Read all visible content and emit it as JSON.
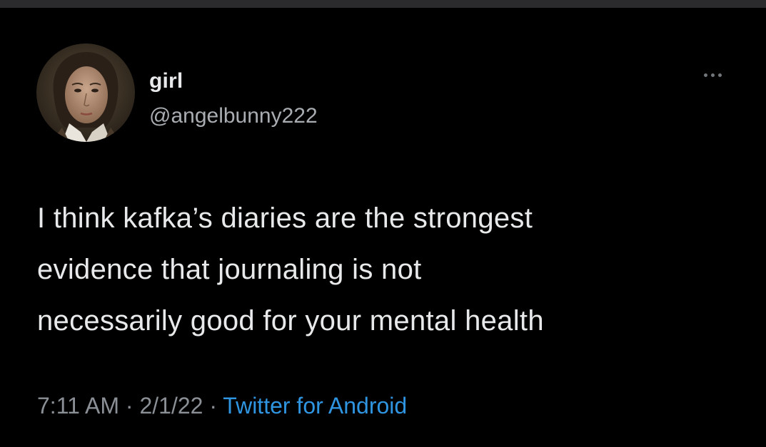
{
  "tweet": {
    "display_name": "girl",
    "handle": "@angelbunny222",
    "more_icon": "more-horizontal-icon",
    "text_lines": [
      "I think kafka’s diaries are the strongest",
      "evidence that journaling is not",
      "necessarily good for your mental health"
    ],
    "time": "7:11 AM",
    "separator": "·",
    "date": "2/1/22",
    "source": "Twitter for Android"
  },
  "colors": {
    "background": "#000000",
    "text_primary": "#e7e9ea",
    "text_secondary": "#8b9096",
    "link": "#2f95e0"
  }
}
